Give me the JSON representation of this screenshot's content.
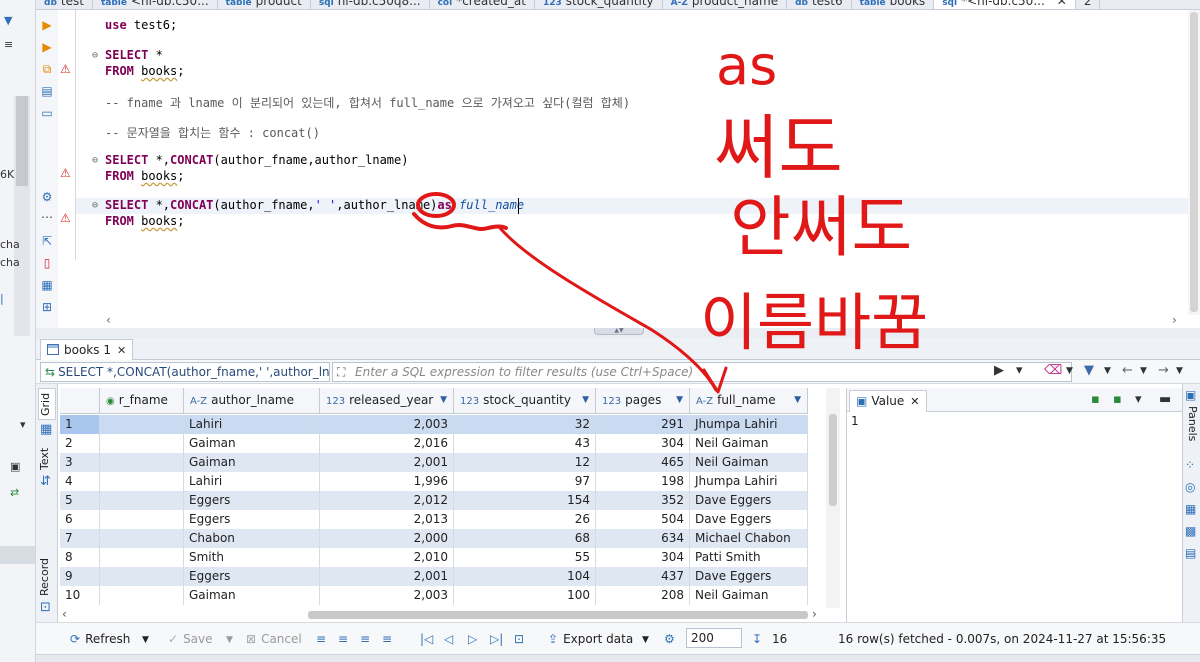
{
  "editor_tabs": [
    {
      "label": "test",
      "icon": "db"
    },
    {
      "label": "<nl-db.c50...",
      "icon": "table"
    },
    {
      "label": "product",
      "icon": "table"
    },
    {
      "label": "nl-db.c50q8...",
      "icon": "sql"
    },
    {
      "label": "*created_at",
      "icon": "col"
    },
    {
      "label": "stock_quantity",
      "icon": "123"
    },
    {
      "label": "product_name",
      "icon": "A-Z"
    },
    {
      "label": "test6",
      "icon": "db"
    },
    {
      "label": "books",
      "icon": "table"
    },
    {
      "label": "*<nl-db.c50...",
      "icon": "sql",
      "active": true,
      "close": "✕"
    },
    {
      "label": "2",
      "icon": ""
    }
  ],
  "left_strip": {
    "texts": [
      "6K",
      "cha",
      "cha"
    ]
  },
  "sql_lines": {
    "l1": {
      "kw": "use",
      "rest": " test6;"
    },
    "l2": {
      "kw": "SELECT",
      "rest": " *"
    },
    "l3": {
      "kw": "FROM",
      "table": "books",
      "end": ";"
    },
    "l4": "-- fname 과 lname 이 분리되어 있는데, 합쳐서 full_name 으로 가져오고 싶다(컬럼 합체)",
    "l5": "-- 문자열을 합치는 함수 : concat()",
    "l6": {
      "kw": "SELECT",
      "mid": " *,",
      "fn": "CONCAT",
      "rest": "(author_fname,author_lname)"
    },
    "l7": {
      "kw": "FROM",
      "table": "books",
      "end": ";"
    },
    "l8": {
      "kw": "SELECT",
      "mid": " *,",
      "fn": "CONCAT",
      "rest1": "(author_fname,",
      "str": "' '",
      "rest2": ",author_lname)",
      "as": "as",
      "alias": " full_name"
    },
    "l9": {
      "kw": "FROM",
      "table": "books",
      "end": ";"
    }
  },
  "result_tab": {
    "label": "books 1",
    "close": "✕"
  },
  "filter_bar": {
    "query_text": "SELECT *,CONCAT(author_fname,' ',author_lname",
    "placeholder": "Enter a SQL expression to filter results (use Ctrl+Space)"
  },
  "side_tabs": {
    "grid": "Grid",
    "text": "Text",
    "record": "Record"
  },
  "grid": {
    "columns": [
      {
        "label": "r_fname",
        "type_icon": "◉"
      },
      {
        "label": "author_lname",
        "type_icon": "A-Z"
      },
      {
        "label": "released_year",
        "type_icon": "123"
      },
      {
        "label": "stock_quantity",
        "type_icon": "123"
      },
      {
        "label": "pages",
        "type_icon": "123"
      },
      {
        "label": "full_name",
        "type_icon": "A-Z"
      }
    ],
    "rows": [
      {
        "n": "1",
        "fname": "",
        "lname": "Lahiri",
        "year": "2,003",
        "stock": "32",
        "pages": "291",
        "full": "Jhumpa Lahiri"
      },
      {
        "n": "2",
        "fname": "",
        "lname": "Gaiman",
        "year": "2,016",
        "stock": "43",
        "pages": "304",
        "full": "Neil Gaiman"
      },
      {
        "n": "3",
        "fname": "",
        "lname": "Gaiman",
        "year": "2,001",
        "stock": "12",
        "pages": "465",
        "full": "Neil Gaiman"
      },
      {
        "n": "4",
        "fname": "",
        "lname": "Lahiri",
        "year": "1,996",
        "stock": "97",
        "pages": "198",
        "full": "Jhumpa Lahiri"
      },
      {
        "n": "5",
        "fname": "",
        "lname": "Eggers",
        "year": "2,012",
        "stock": "154",
        "pages": "352",
        "full": "Dave Eggers"
      },
      {
        "n": "6",
        "fname": "",
        "lname": "Eggers",
        "year": "2,013",
        "stock": "26",
        "pages": "504",
        "full": "Dave Eggers"
      },
      {
        "n": "7",
        "fname": "",
        "lname": "Chabon",
        "year": "2,000",
        "stock": "68",
        "pages": "634",
        "full": "Michael Chabon"
      },
      {
        "n": "8",
        "fname": "",
        "lname": "Smith",
        "year": "2,010",
        "stock": "55",
        "pages": "304",
        "full": "Patti Smith"
      },
      {
        "n": "9",
        "fname": "",
        "lname": "Eggers",
        "year": "2,001",
        "stock": "104",
        "pages": "437",
        "full": "Dave Eggers"
      },
      {
        "n": "10",
        "fname": "",
        "lname": "Gaiman",
        "year": "2,003",
        "stock": "100",
        "pages": "208",
        "full": "Neil Gaiman"
      }
    ]
  },
  "value_panel": {
    "tab": "Value",
    "close": "✕",
    "value": "1"
  },
  "right_rail": {
    "label": "Panels"
  },
  "bottom_bar": {
    "refresh": "Refresh",
    "save": "Save",
    "cancel": "Cancel",
    "export": "Export data",
    "fetch_size": "200",
    "fetched_count": "16",
    "status": "16 row(s) fetched - 0.007s, on 2024-11-27 at 15:56:35"
  },
  "annotations": {
    "color": "#e01818",
    "lines": [
      "as",
      "써도",
      "안써도",
      "이름바꿈"
    ]
  }
}
